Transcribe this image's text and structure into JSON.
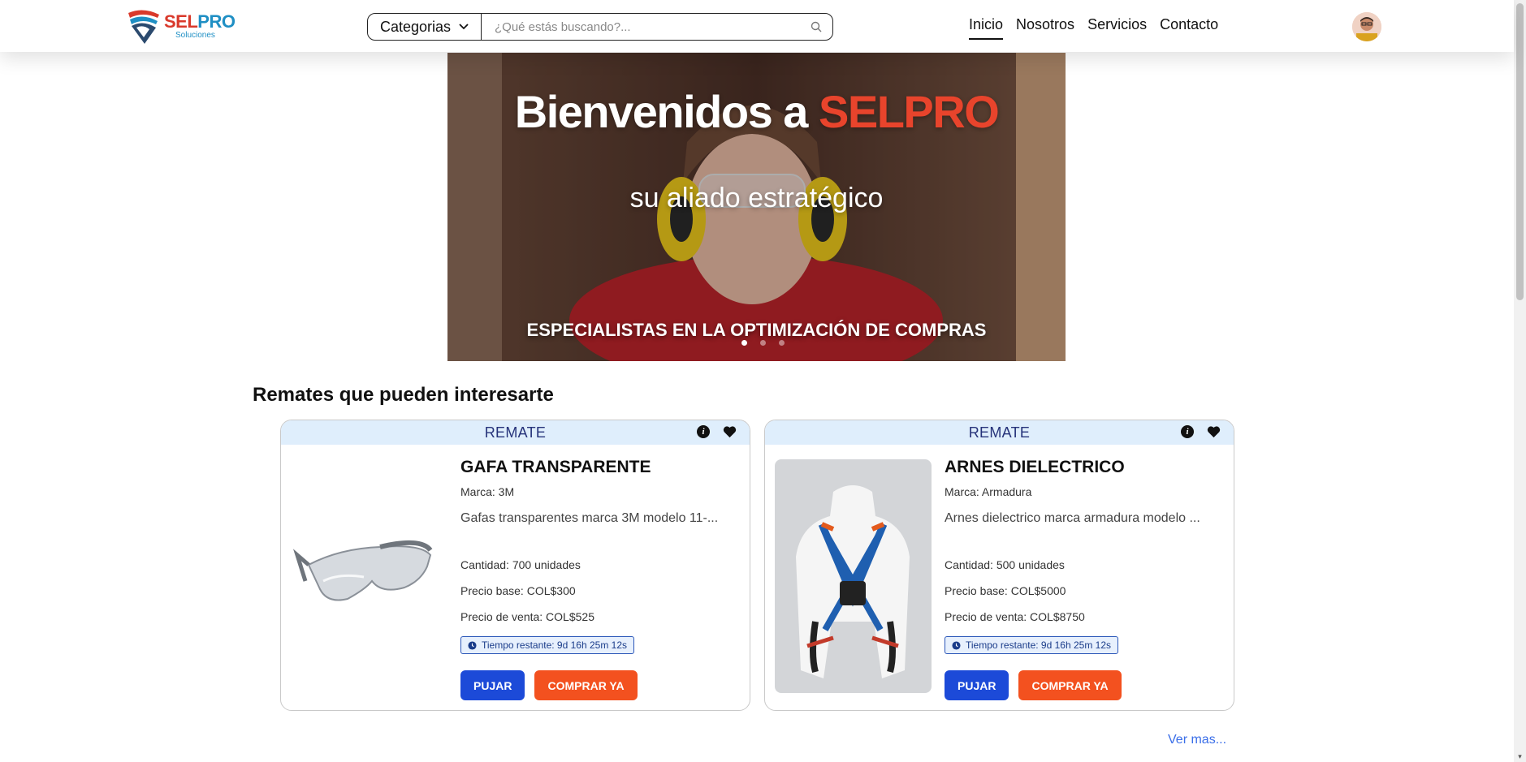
{
  "header": {
    "logo": {
      "word_sel": "SEL",
      "word_pro": "PRO",
      "tagline": "Soluciones"
    },
    "search": {
      "category_label": "Categorias",
      "placeholder": "¿Qué estás buscando?..."
    },
    "nav": [
      {
        "label": "Inicio",
        "active": true
      },
      {
        "label": "Nosotros",
        "active": false
      },
      {
        "label": "Servicios",
        "active": false
      },
      {
        "label": "Contacto",
        "active": false
      }
    ]
  },
  "hero": {
    "title_prefix": "Bienvenidos a ",
    "title_brand": "SELPRO",
    "subtitle": "su aliado estratégico",
    "caption": "ESPECIALISTAS EN LA OPTIMIZACIÓN DE COMPRAS",
    "slide_count": 3,
    "active_slide": 1
  },
  "auctions": {
    "section_title": "Remates que pueden interesarte",
    "cards": [
      {
        "tag": "REMATE",
        "name": "GAFA TRANSPARENTE",
        "brand": "Marca: 3M",
        "description": "Gafas transparentes marca 3M modelo 11-...",
        "quantity": "Cantidad: 700 unidades",
        "base_price": "Precio base: COL$300",
        "sale_price": "Precio de venta: COL$525",
        "time_left": "Tiempo restante: 9d 16h 25m 12s",
        "bid_label": "PUJAR",
        "buy_label": "COMPRAR YA"
      },
      {
        "tag": "REMATE",
        "name": "ARNES DIELECTRICO",
        "brand": "Marca: Armadura",
        "description": "Arnes dielectrico marca armadura modelo ...",
        "quantity": "Cantidad: 500 unidades",
        "base_price": "Precio base: COL$5000",
        "sale_price": "Precio de venta: COL$8750",
        "time_left": "Tiempo restante: 9d 16h 25m 12s",
        "bid_label": "PUJAR",
        "buy_label": "COMPRAR YA"
      }
    ],
    "see_more": "Ver mas..."
  },
  "colors": {
    "brand_red": "#e8442c",
    "brand_blue": "#1f8fc4",
    "bid_button": "#1c4ad8",
    "buy_button": "#f3511f",
    "card_header": "#dfeefc",
    "link": "#3a6ee8"
  }
}
